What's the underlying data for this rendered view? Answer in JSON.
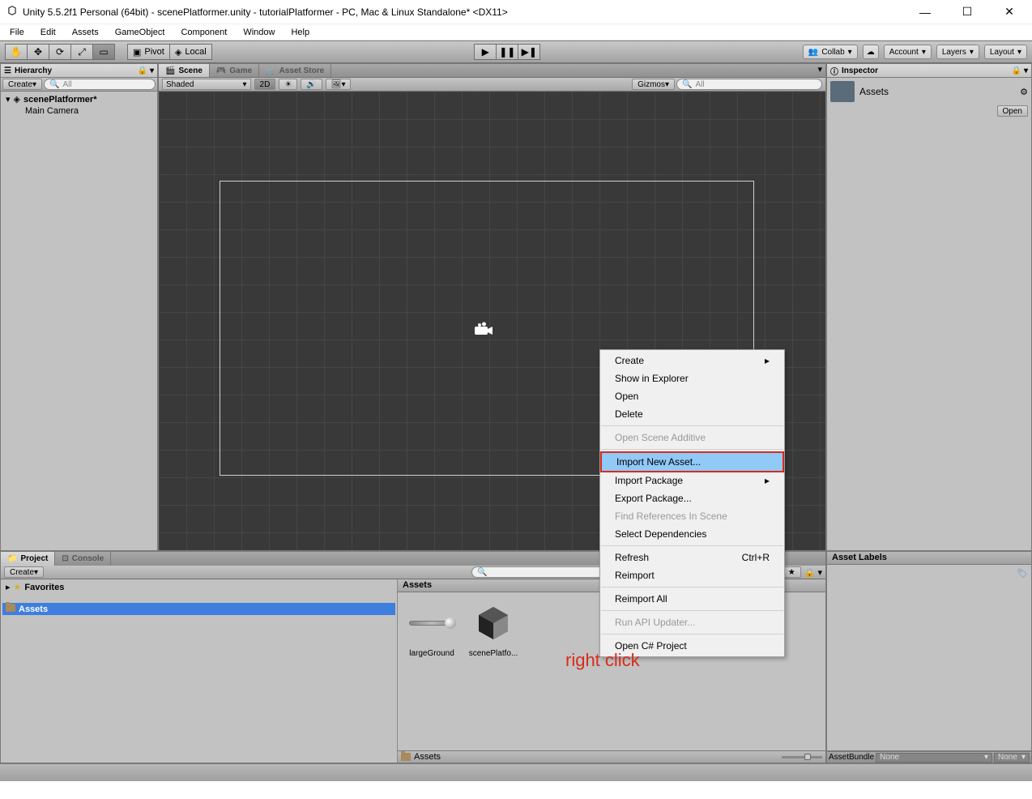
{
  "window": {
    "title": "Unity 5.5.2f1 Personal (64bit) - scenePlatformer.unity - tutorialPlatformer - PC, Mac & Linux Standalone* <DX11>"
  },
  "menubar": [
    "File",
    "Edit",
    "Assets",
    "GameObject",
    "Component",
    "Window",
    "Help"
  ],
  "toolbar": {
    "pivot": "Pivot",
    "local": "Local",
    "collab": "Collab",
    "account": "Account",
    "layers": "Layers",
    "layout": "Layout"
  },
  "hierarchy": {
    "tab": "Hierarchy",
    "create": "Create",
    "search_placeholder": "All",
    "scene": "scenePlatformer*",
    "items": [
      "Main Camera"
    ]
  },
  "scene": {
    "tabs": [
      {
        "label": "Scene",
        "active": true
      },
      {
        "label": "Game",
        "active": false
      },
      {
        "label": "Asset Store",
        "active": false
      }
    ],
    "shaded": "Shaded",
    "mode2d": "2D",
    "gizmos": "Gizmos",
    "search_placeholder": "All"
  },
  "inspector": {
    "tab": "Inspector",
    "title": "Assets",
    "open": "Open",
    "labels": "Asset Labels",
    "assetbundle": "AssetBundle",
    "none1": "None",
    "none2": "None"
  },
  "project": {
    "tab": "Project",
    "console_tab": "Console",
    "create": "Create",
    "favorites": "Favorites",
    "assets_folder": "Assets",
    "assets_header": "Assets",
    "items": [
      {
        "label": "largeGround"
      },
      {
        "label": "scenePlatfo..."
      }
    ],
    "footer_path": "Assets"
  },
  "context_menu": {
    "items": [
      {
        "label": "Create",
        "submenu": true
      },
      {
        "label": "Show in Explorer"
      },
      {
        "label": "Open"
      },
      {
        "label": "Delete"
      },
      {
        "sep": true
      },
      {
        "label": "Open Scene Additive",
        "disabled": true
      },
      {
        "sep": true
      },
      {
        "label": "Import New Asset...",
        "highlight": true
      },
      {
        "label": "Import Package",
        "submenu": true
      },
      {
        "label": "Export Package..."
      },
      {
        "label": "Find References In Scene",
        "disabled": true
      },
      {
        "label": "Select Dependencies"
      },
      {
        "sep": true
      },
      {
        "label": "Refresh",
        "shortcut": "Ctrl+R"
      },
      {
        "label": "Reimport"
      },
      {
        "sep": true
      },
      {
        "label": "Reimport All"
      },
      {
        "sep": true
      },
      {
        "label": "Run API Updater...",
        "disabled": true
      },
      {
        "sep": true
      },
      {
        "label": "Open C# Project"
      }
    ]
  },
  "annotation": "right click"
}
